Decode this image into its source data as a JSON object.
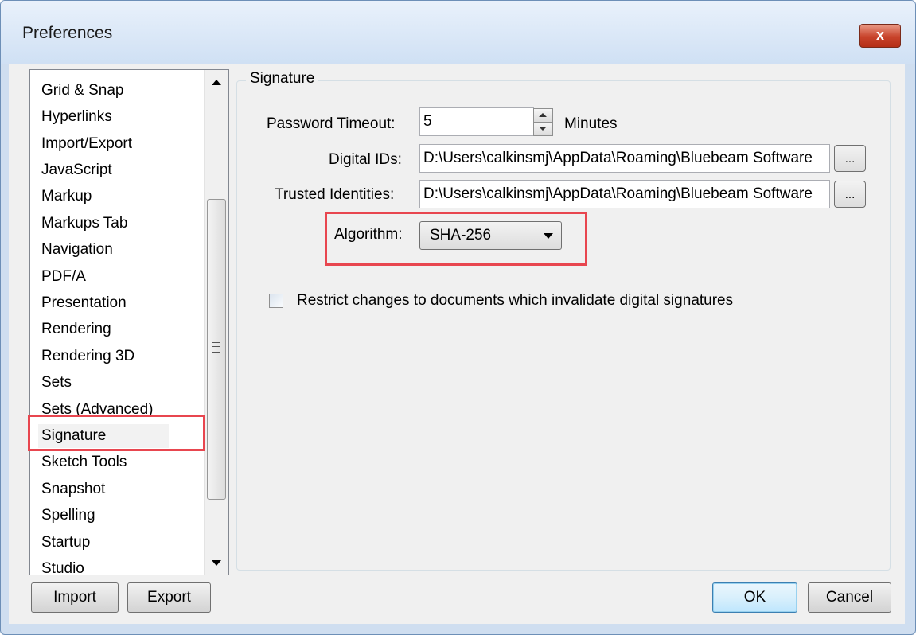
{
  "window": {
    "title": "Preferences",
    "close_glyph": "x"
  },
  "list": {
    "items": [
      "Grid & Snap",
      "Hyperlinks",
      "Import/Export",
      "JavaScript",
      "Markup",
      "Markups Tab",
      "Navigation",
      "PDF/A",
      "Presentation",
      "Rendering",
      "Rendering 3D",
      "Sets",
      "Sets (Advanced)",
      "Signature",
      "Sketch Tools",
      "Snapshot",
      "Spelling",
      "Startup",
      "Studio"
    ],
    "selected": "Signature"
  },
  "signature": {
    "group_title": "Signature",
    "password_timeout_label": "Password Timeout:",
    "password_timeout_value": "5",
    "minutes_label": "Minutes",
    "digital_ids_label": "Digital IDs:",
    "digital_ids_value": "D:\\Users\\calkinsmj\\AppData\\Roaming\\Bluebeam Software",
    "trusted_label": "Trusted Identities:",
    "trusted_value": "D:\\Users\\calkinsmj\\AppData\\Roaming\\Bluebeam Software",
    "browse_label": "...",
    "algorithm_label": "Algorithm:",
    "algorithm_value": "SHA-256",
    "restrict_label": "Restrict changes to documents which invalidate digital signatures",
    "restrict_checked": false
  },
  "buttons": {
    "import": "Import",
    "export": "Export",
    "ok": "OK",
    "cancel": "Cancel"
  },
  "colors": {
    "highlight": "#e8464f",
    "title_bar": "#cfe0f4",
    "close_button": "#c8432b"
  }
}
